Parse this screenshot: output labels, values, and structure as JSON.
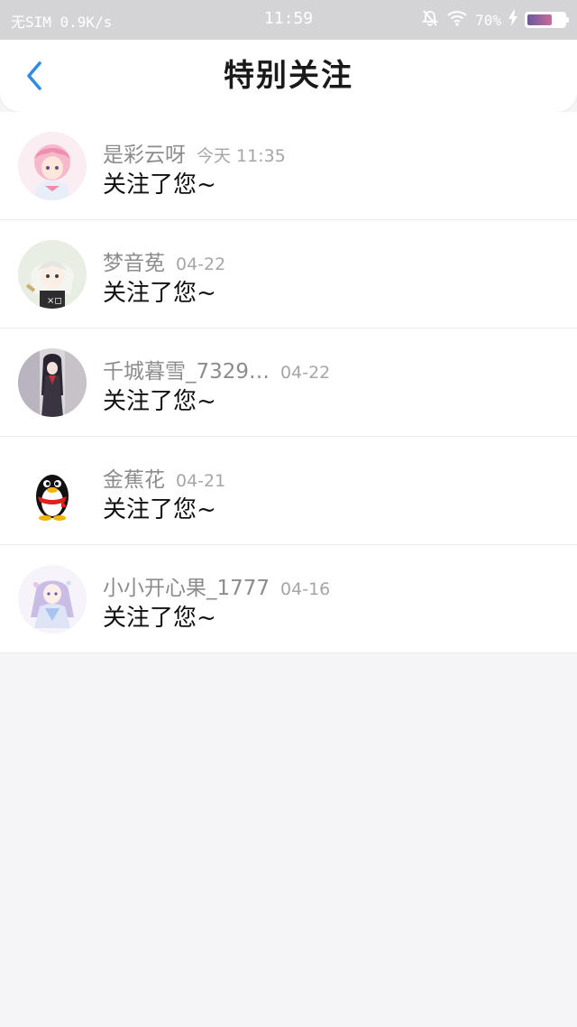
{
  "status_bar": {
    "carrier": "无SIM 0.9K/s",
    "time": "11:59",
    "battery_percent": "70%",
    "battery_level": 0.7,
    "icons": [
      "mute-bell-icon",
      "wifi-icon",
      "charging-icon",
      "battery-icon"
    ]
  },
  "header": {
    "title": "特别关注",
    "back_icon": "chevron-left-icon",
    "accent_color": "#2b8ce8"
  },
  "list": {
    "items": [
      {
        "name": "是彩云呀",
        "time": "今天 11:35",
        "message": "关注了您~",
        "avatar": "anime-pink-hair-avatar"
      },
      {
        "name": "梦音莬",
        "time": "04-22",
        "message": "关注了您~",
        "avatar": "anime-white-hair-avatar"
      },
      {
        "name": "千城暮雪_7329…",
        "time": "04-22",
        "message": "关注了您~",
        "avatar": "anime-dark-figure-avatar"
      },
      {
        "name": "金蕉花",
        "time": "04-21",
        "message": "关注了您~",
        "avatar": "qq-penguin-avatar"
      },
      {
        "name": "小小开心果_1777",
        "time": "04-16",
        "message": "关注了您~",
        "avatar": "anime-lavender-avatar"
      }
    ]
  }
}
